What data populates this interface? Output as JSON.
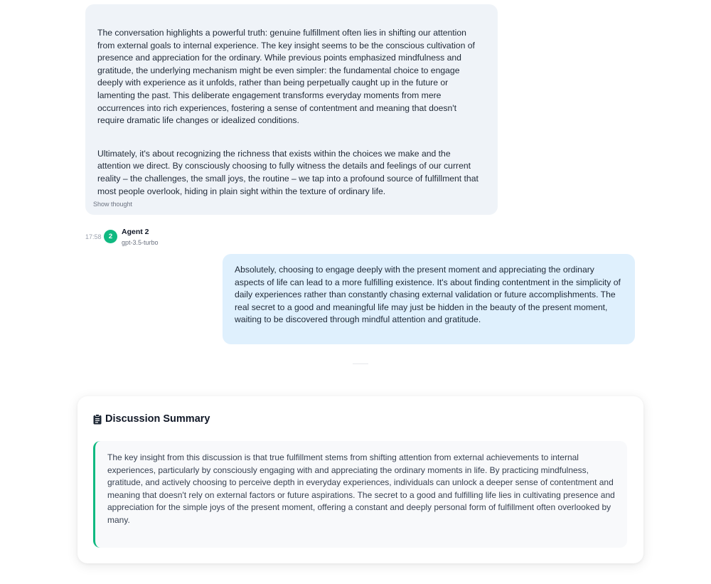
{
  "messages": [
    {
      "paragraphs": [
        "The conversation highlights a powerful truth: genuine fulfillment often lies in shifting our attention from external goals to internal experience. The key insight seems to be the conscious cultivation of presence and appreciation for the ordinary. While previous points emphasized mindfulness and gratitude, the underlying mechanism might be even simpler: the fundamental choice to engage deeply with experience as it unfolds, rather than being perpetually caught up in the future or lamenting the past. This deliberate engagement transforms everyday moments from mere occurrences into rich experiences, fostering a sense of contentment and meaning that doesn't require dramatic life changes or idealized conditions.",
        "Ultimately, it's about recognizing the richness that exists within the choices we make and the attention we direct. By consciously choosing to fully witness the details and feelings of our current reality – the challenges, the small joys, the routine – we tap into a profound source of fulfillment that most people overlook, hiding in plain sight within the texture of ordinary life."
      ],
      "show_thought_label": "Show thought"
    },
    {
      "time": "17:58",
      "avatar": "2",
      "agent_name": "Agent 2",
      "model": "gpt-3.5-turbo",
      "text": "Absolutely, choosing to engage deeply with the present moment and appreciating the ordinary aspects of life can lead to a more fulfilling existence. It's about finding contentment in the simplicity of daily experiences rather than constantly chasing external validation or future accomplishments. The real secret to a good and meaningful life may just be hidden in the beauty of the present moment, waiting to be discovered through mindful attention and gratitude."
    }
  ],
  "summary": {
    "icon": "clipboard-icon",
    "title": "Discussion Summary",
    "text": "The key insight from this discussion is that true fulfillment stems from shifting attention from external achievements to internal experiences, particularly by consciously engaging with and appreciating the ordinary moments in life. By practicing mindfulness, gratitude, and actively choosing to perceive depth in everyday experiences, individuals can unlock a deeper sense of contentment and meaning that doesn't rely on external factors or future aspirations. The secret to a good and fulfilling life lies in cultivating presence and appreciation for the simple joys of the present moment, offering a constant and deeply personal form of fulfillment often overlooked by many."
  },
  "colors": {
    "agent1_bubble": "#eff3f8",
    "agent2_bubble": "#dff0fd",
    "accent_green": "#10b981"
  }
}
